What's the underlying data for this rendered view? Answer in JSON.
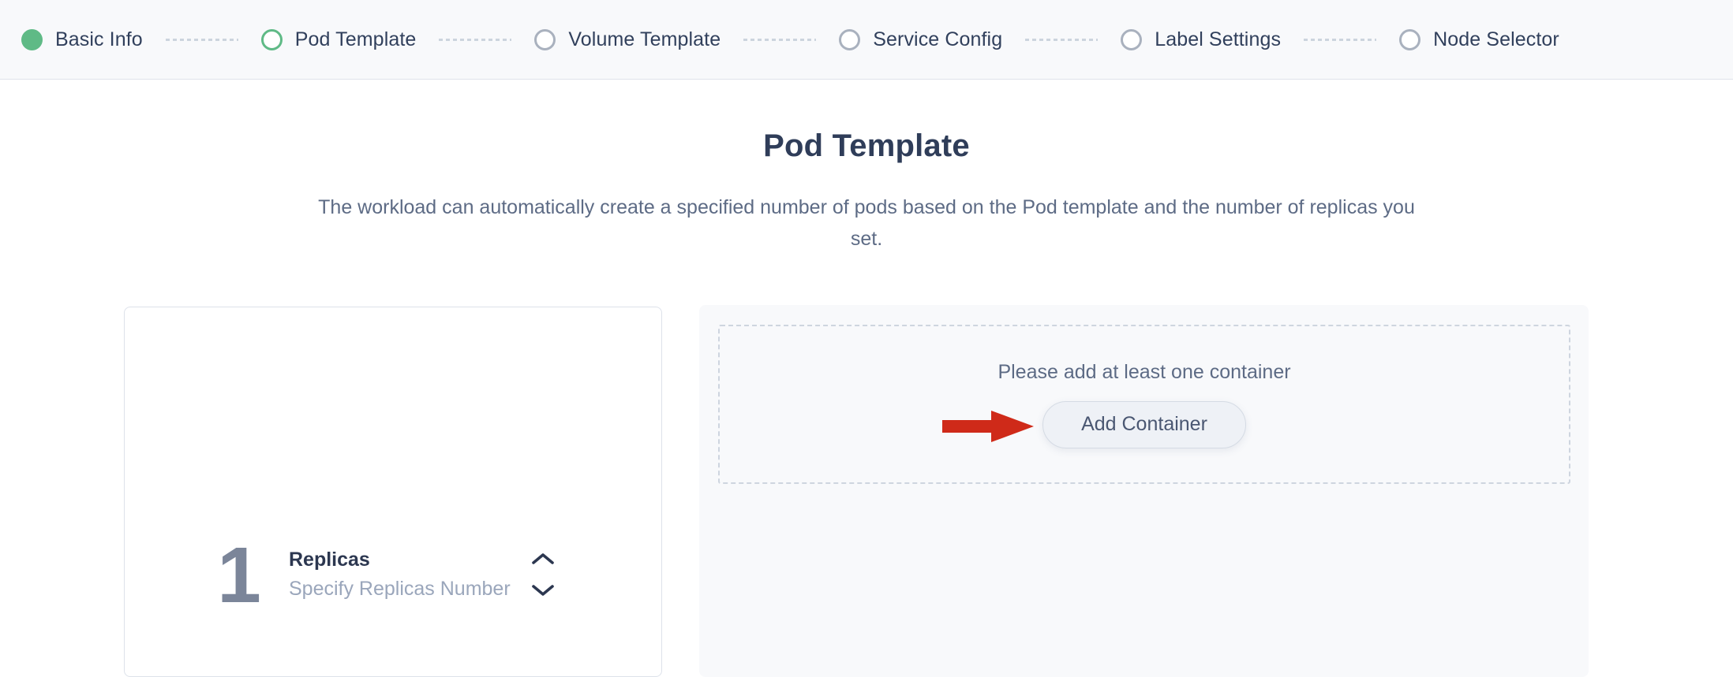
{
  "stepper": {
    "steps": [
      {
        "label": "Basic Info",
        "state": "done"
      },
      {
        "label": "Pod Template",
        "state": "active"
      },
      {
        "label": "Volume Template",
        "state": "todo"
      },
      {
        "label": "Service Config",
        "state": "todo"
      },
      {
        "label": "Label Settings",
        "state": "todo"
      },
      {
        "label": "Node Selector",
        "state": "todo"
      }
    ],
    "colors": {
      "done": "#5fba86",
      "active": "#5fba86",
      "todo": "#a9b1be",
      "connector": "#ccd4de"
    }
  },
  "page": {
    "title": "Pod Template",
    "subtitle": "The workload can automatically create a specified number of pods based on the Pod template and the number of replicas you set."
  },
  "replicas": {
    "value": "1",
    "title": "Replicas",
    "hint": "Specify Replicas Number",
    "increment_icon": "chevron-up-icon",
    "decrement_icon": "chevron-down-icon"
  },
  "containers": {
    "empty_message": "Please add at least one container",
    "add_button_label": "Add Container"
  },
  "annotation": {
    "arrow_icon": "arrow-right-icon",
    "arrow_color": "#cf2a19"
  }
}
